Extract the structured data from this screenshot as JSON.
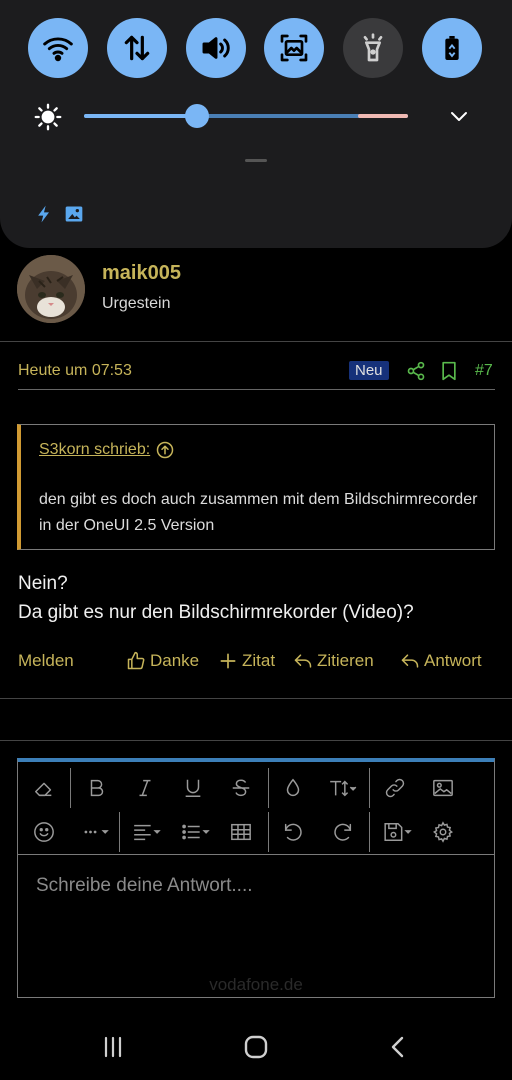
{
  "quick_settings": {
    "toggles": [
      {
        "icon": "wifi-icon",
        "on": true
      },
      {
        "icon": "mobile-data-icon",
        "on": true
      },
      {
        "icon": "sound-icon",
        "on": true
      },
      {
        "icon": "screenshot-icon",
        "on": true
      },
      {
        "icon": "flashlight-icon",
        "on": false
      },
      {
        "icon": "power-saving-icon",
        "on": true
      }
    ],
    "brightness": 0.35,
    "accent": "#7ab6f5"
  },
  "post": {
    "username": "maik005",
    "rank": "Urgestein",
    "date": "Heute um 07:53",
    "badge": "Neu",
    "number": "#7",
    "quote": {
      "author": "S3korn schrieb:",
      "text": "den gibt es doch auch zusammen mit dem Bildschirmrecorder in der OneUI 2.5 Version"
    },
    "body_line1": "Nein?",
    "body_line2": "Da gibt es nur den Bildschirmrekorder (Video)?",
    "actions": {
      "report": "Melden",
      "thanks": "Danke",
      "quote": "Zitat",
      "cite": "Zitieren",
      "reply": "Antwort"
    }
  },
  "editor": {
    "placeholder": "Schreibe deine Antwort....",
    "toolbar_row1": [
      "eraser-icon",
      "bold-icon",
      "italic-icon",
      "underline-icon",
      "strikethrough-icon",
      "color-icon",
      "font-size-icon",
      "link-icon",
      "image-icon"
    ],
    "toolbar_row2": [
      "emoji-icon",
      "more-icon",
      "align-icon",
      "list-icon",
      "table-icon",
      "undo-icon",
      "redo-icon",
      "save-icon",
      "settings-icon"
    ]
  },
  "watermark": "vodafone.de",
  "colors": {
    "gold": "#c6b45a",
    "green": "#59b94c",
    "badge_bg": "#16317a",
    "quote_border": "#d09a33",
    "editor_top": "#3c7fb8"
  }
}
